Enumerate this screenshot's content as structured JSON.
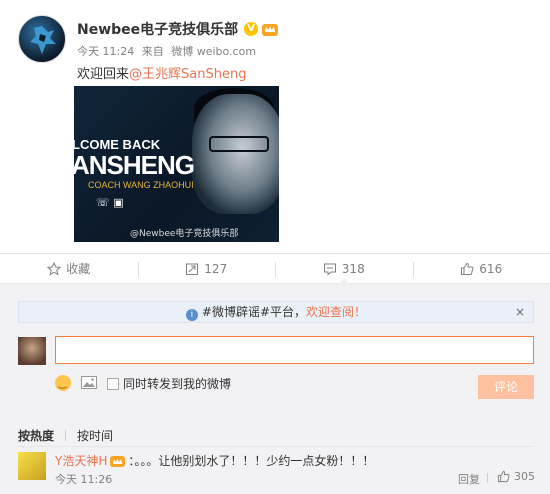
{
  "post": {
    "author": "Newbee电子竞技俱乐部",
    "verified_mark": "V",
    "time": "今天 11:24",
    "source_prefix": "来自",
    "source": "微博 weibo.com",
    "text_prefix": "欢迎回来",
    "mention": "@王兆辉SanSheng",
    "image": {
      "line1": "LCOME BACK",
      "line2": "ANSHENG",
      "line3": "COACH WANG ZHAOHUI",
      "watermark": "@Newbee电子竞技俱乐部"
    }
  },
  "actions": {
    "favorite": "收藏",
    "repost": "127",
    "comment": "318",
    "like": "616"
  },
  "comments": {
    "notice_prefix": "#微博辟谣#平台，",
    "notice_link": "欢迎查阅！",
    "notice_close": "×",
    "repost_label": "同时转发到我的微博",
    "submit_label": "评论",
    "sort_hot": "按热度",
    "sort_time": "按时间",
    "items": [
      {
        "user": "Y浩天神H",
        "text": "：。。。让他别划水了！！！少约一点女粉！！！",
        "time": "今天 11:26",
        "reply": "回复",
        "likes": "305"
      }
    ]
  },
  "colors": {
    "accent": "#eb7350",
    "input_border": "#fa7d3c",
    "submit_disabled": "#ffc09f",
    "panel_bg": "#f2f2f5"
  }
}
